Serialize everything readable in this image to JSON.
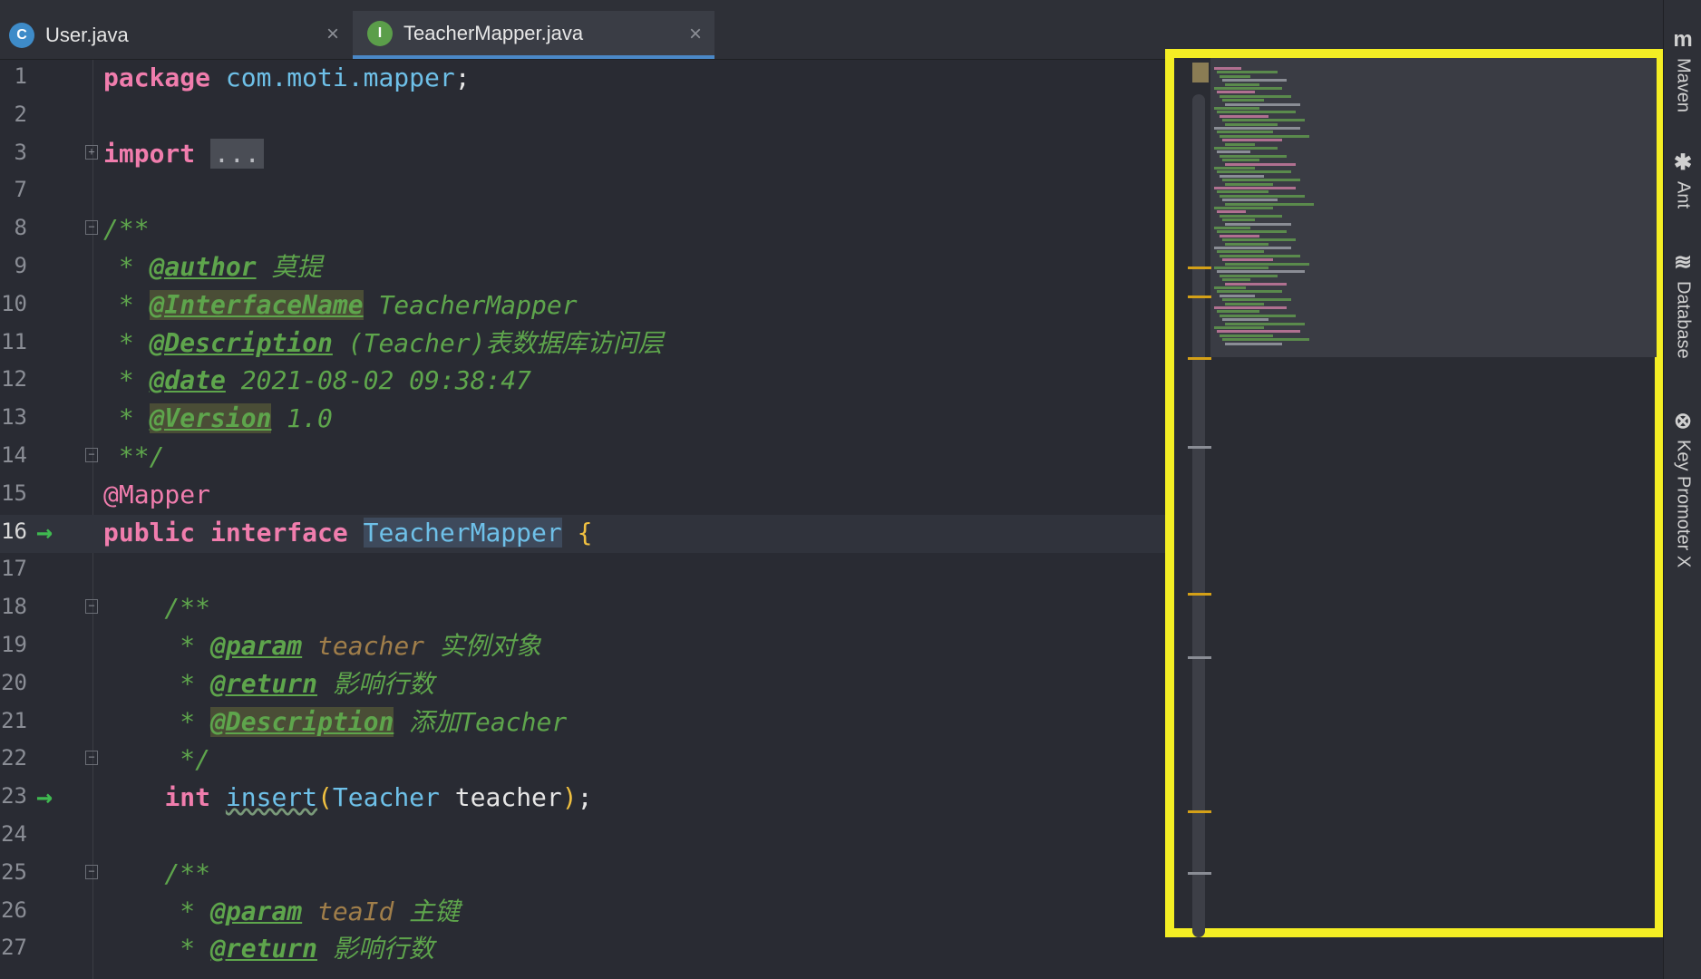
{
  "tabs": [
    {
      "label": "User.java",
      "icon": "java-class-icon",
      "icon_glyph": "C",
      "active": false
    },
    {
      "label": "TeacherMapper.java",
      "icon": "java-interface-icon",
      "icon_glyph": "I",
      "active": true
    }
  ],
  "code_lines": [
    {
      "num": "1",
      "segments": [
        {
          "t": "package",
          "c": "kw"
        },
        {
          "t": " ",
          "c": "plain"
        },
        {
          "t": "com.moti.mapper",
          "c": "pkg"
        },
        {
          "t": ";",
          "c": "plain"
        }
      ]
    },
    {
      "num": "2",
      "segments": []
    },
    {
      "num": "3",
      "fold": "plus",
      "segments": [
        {
          "t": "import",
          "c": "kw"
        },
        {
          "t": " ",
          "c": "plain"
        },
        {
          "t": "...",
          "c": "fold-box"
        }
      ]
    },
    {
      "num": "7",
      "segments": []
    },
    {
      "num": "8",
      "fold": "minus",
      "segments": [
        {
          "t": "/**",
          "c": "doc"
        }
      ]
    },
    {
      "num": "9",
      "segments": [
        {
          "t": " * ",
          "c": "doc"
        },
        {
          "t": "@author",
          "c": "dtag"
        },
        {
          "t": " 莫提",
          "c": "doc"
        }
      ]
    },
    {
      "num": "10",
      "segments": [
        {
          "t": " * ",
          "c": "doc"
        },
        {
          "t": "@InterfaceName",
          "c": "dtag hl"
        },
        {
          "t": " TeacherMapper",
          "c": "doc"
        }
      ]
    },
    {
      "num": "11",
      "segments": [
        {
          "t": " * ",
          "c": "doc"
        },
        {
          "t": "@Description",
          "c": "dtag"
        },
        {
          "t": " (Teacher)表数据库访问层",
          "c": "doc"
        }
      ]
    },
    {
      "num": "12",
      "segments": [
        {
          "t": " * ",
          "c": "doc"
        },
        {
          "t": "@date",
          "c": "dtag"
        },
        {
          "t": " 2021-08-02 09:38:47",
          "c": "doc"
        }
      ]
    },
    {
      "num": "13",
      "segments": [
        {
          "t": " * ",
          "c": "doc"
        },
        {
          "t": "@Version",
          "c": "dtag hl"
        },
        {
          "t": " 1.0",
          "c": "doc"
        }
      ]
    },
    {
      "num": "14",
      "fold": "minus",
      "segments": [
        {
          "t": " **/",
          "c": "doc"
        }
      ]
    },
    {
      "num": "15",
      "segments": [
        {
          "t": "@Mapper",
          "c": "ann"
        }
      ]
    },
    {
      "num": "16",
      "current": true,
      "gutter_icon": "implemented-arrow-icon",
      "segments": [
        {
          "t": "public",
          "c": "kw"
        },
        {
          "t": " ",
          "c": "plain"
        },
        {
          "t": "interface",
          "c": "kw"
        },
        {
          "t": " ",
          "c": "plain"
        },
        {
          "t": "TeacherMapper",
          "c": "typehl"
        },
        {
          "t": " ",
          "c": "plain"
        },
        {
          "t": "{",
          "c": "brace"
        }
      ]
    },
    {
      "num": "17",
      "segments": []
    },
    {
      "num": "18",
      "fold": "minus",
      "segments": [
        {
          "t": "    /**",
          "c": "doc"
        }
      ]
    },
    {
      "num": "19",
      "segments": [
        {
          "t": "     * ",
          "c": "doc"
        },
        {
          "t": "@param",
          "c": "dtag"
        },
        {
          "t": " ",
          "c": "doc"
        },
        {
          "t": "teacher",
          "c": "docparam"
        },
        {
          "t": " 实例对象",
          "c": "doc"
        }
      ]
    },
    {
      "num": "20",
      "segments": [
        {
          "t": "     * ",
          "c": "doc"
        },
        {
          "t": "@return",
          "c": "dtag"
        },
        {
          "t": " 影响行数",
          "c": "doc"
        }
      ]
    },
    {
      "num": "21",
      "segments": [
        {
          "t": "     * ",
          "c": "doc"
        },
        {
          "t": "@Description",
          "c": "dtag hl"
        },
        {
          "t": " 添加Teacher",
          "c": "doc"
        }
      ]
    },
    {
      "num": "22",
      "fold": "minus",
      "segments": [
        {
          "t": "     */",
          "c": "doc"
        }
      ]
    },
    {
      "num": "23",
      "gutter_icon": "implemented-arrow-icon",
      "segments": [
        {
          "t": "    ",
          "c": "plain"
        },
        {
          "t": "int",
          "c": "kw"
        },
        {
          "t": " ",
          "c": "plain"
        },
        {
          "t": "insert",
          "c": "method"
        },
        {
          "t": "(",
          "c": "brace"
        },
        {
          "t": "Teacher",
          "c": "type"
        },
        {
          "t": " teacher",
          "c": "plain"
        },
        {
          "t": ")",
          "c": "brace"
        },
        {
          "t": ";",
          "c": "plain"
        }
      ]
    },
    {
      "num": "24",
      "segments": []
    },
    {
      "num": "25",
      "fold": "minus",
      "segments": [
        {
          "t": "    /**",
          "c": "doc"
        }
      ]
    },
    {
      "num": "26",
      "segments": [
        {
          "t": "     * ",
          "c": "doc"
        },
        {
          "t": "@param",
          "c": "dtag"
        },
        {
          "t": " ",
          "c": "doc"
        },
        {
          "t": "teaId",
          "c": "docparam"
        },
        {
          "t": " 主键",
          "c": "doc"
        }
      ]
    },
    {
      "num": "27",
      "segments": [
        {
          "t": "     * ",
          "c": "doc"
        },
        {
          "t": "@return",
          "c": "dtag"
        },
        {
          "t": " 影响行数",
          "c": "doc"
        }
      ]
    }
  ],
  "sidebar": [
    {
      "label": "Maven",
      "icon": "maven-icon",
      "glyph": "m"
    },
    {
      "label": "Ant",
      "icon": "ant-icon",
      "glyph": "✱"
    },
    {
      "label": "Database",
      "icon": "database-icon",
      "glyph": "≋"
    },
    {
      "label": "Key Promoter X",
      "icon": "key-promoter-icon",
      "glyph": "⊗"
    }
  ],
  "colors": {
    "highlight_border": "#f4ee24",
    "tab_underline": "#4a88c7"
  }
}
